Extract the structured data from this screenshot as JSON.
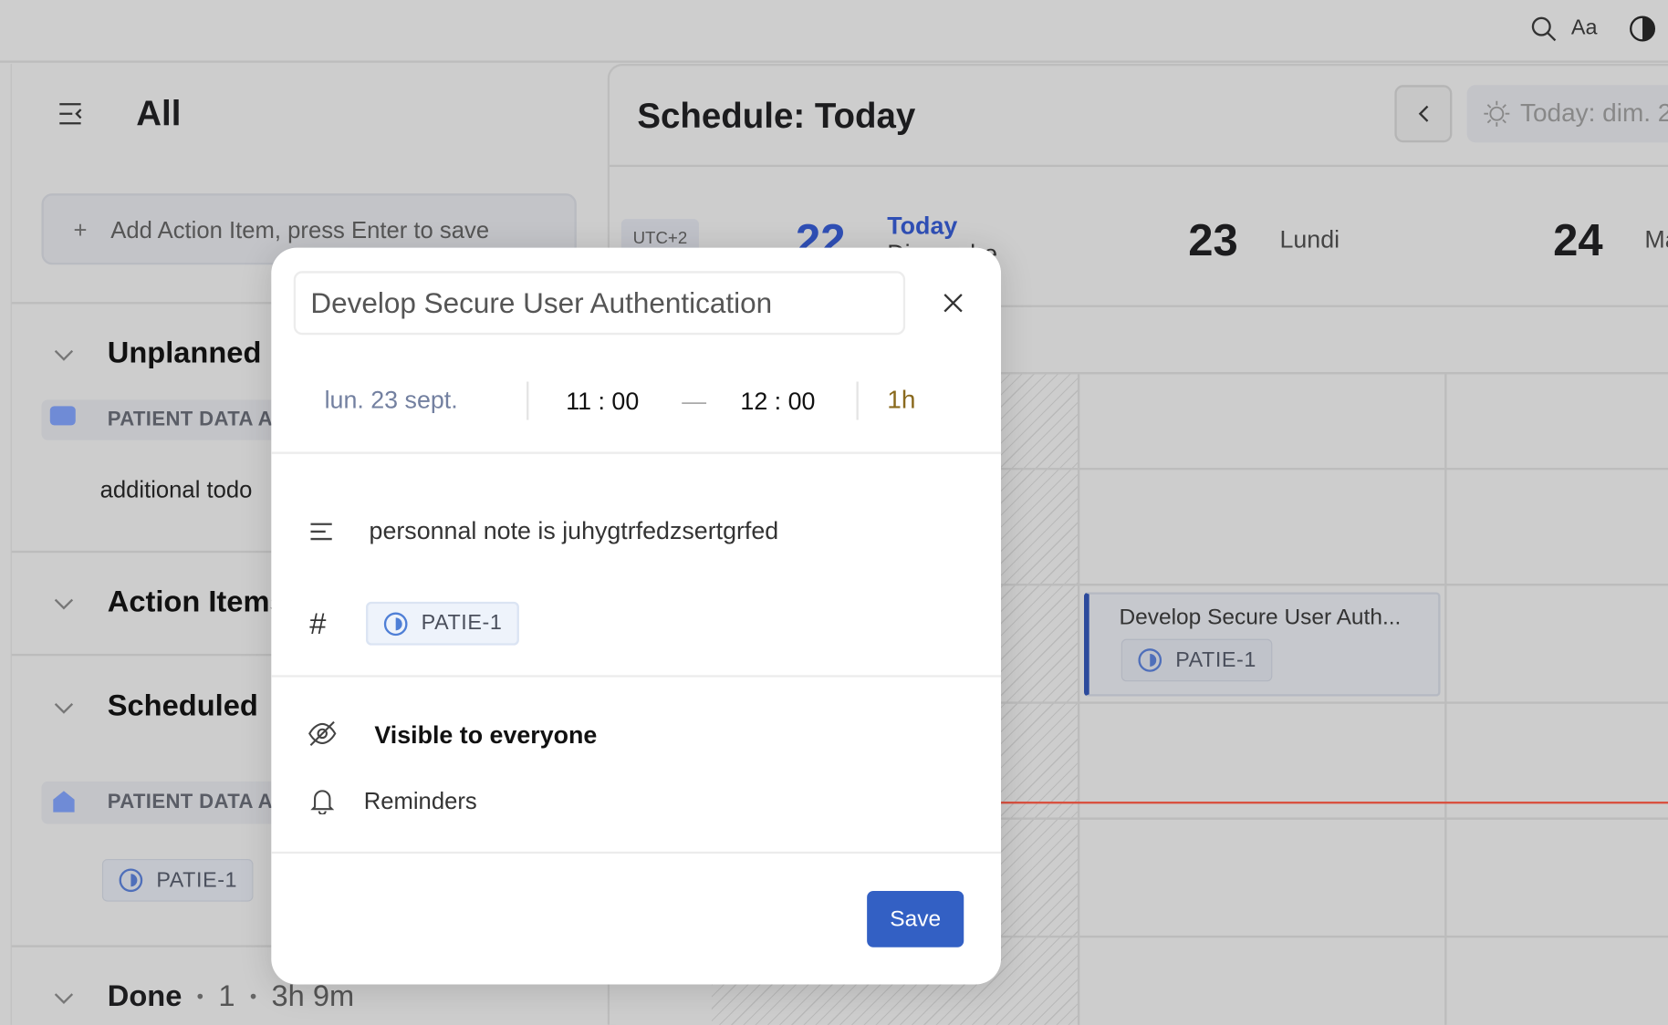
{
  "topbar": {
    "icons": [
      "search-icon",
      "font-size-icon",
      "contrast-icon"
    ],
    "font_label": "Aa"
  },
  "sidebar": {
    "title": "All",
    "add_placeholder": "Add Action Item, press Enter to save",
    "sections": [
      {
        "label": "Unplanned",
        "items": [
          {
            "label": "PATIENT DATA A"
          }
        ],
        "extra": "additional todo"
      },
      {
        "label": "Action Items"
      },
      {
        "label": "Scheduled",
        "items": [
          {
            "label": "PATIENT DATA A",
            "tag": "PATIE-1"
          }
        ]
      },
      {
        "label": "Done",
        "count": "1",
        "duration": "3h 9m"
      }
    ]
  },
  "schedule": {
    "title": "Schedule: Today",
    "today_button": "Today: dim. 2",
    "timezone": "UTC+2",
    "days": [
      {
        "num": "22",
        "label": "Today",
        "sub": "Dimanche",
        "today": true
      },
      {
        "num": "23",
        "label": "Lundi"
      },
      {
        "num": "24",
        "label": "Ma"
      }
    ],
    "event": {
      "title": "Develop Secure User Auth...",
      "tag": "PATIE-1"
    },
    "now_line_color": "#d9503f"
  },
  "modal": {
    "title": "Develop Secure User Authentication",
    "date": "lun. 23 sept.",
    "start": "11 : 00",
    "dash": "—",
    "end": "12 : 00",
    "duration": "1h",
    "note": "personnal note is juhygtrfedzsertgrfed",
    "tag": "PATIE-1",
    "visibility": "Visible to everyone",
    "reminders": "Reminders",
    "save": "Save"
  },
  "colors": {
    "accent": "#3360c4",
    "today_blue": "#2f4fb5",
    "duration": "#8a6a1e"
  }
}
